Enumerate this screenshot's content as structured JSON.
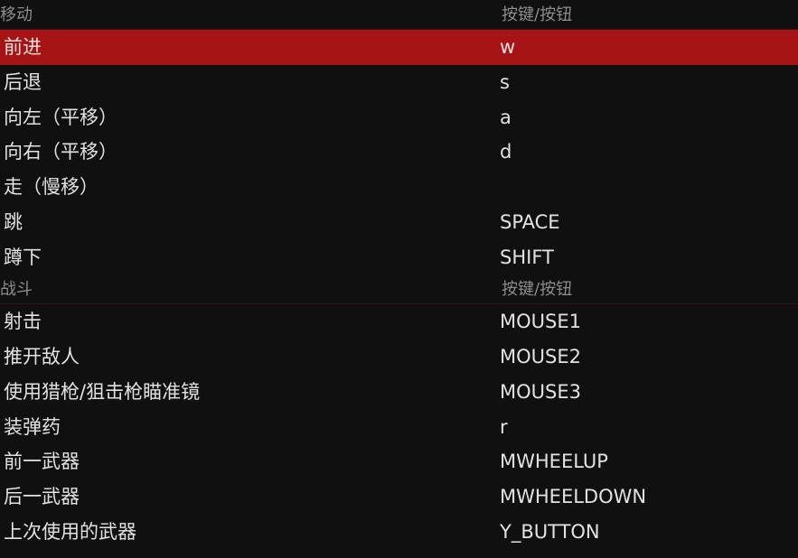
{
  "sections": [
    {
      "title": "移动",
      "key_header": "按键/按钮",
      "rows": [
        {
          "action": "前进",
          "key": "w",
          "selected": true
        },
        {
          "action": "后退",
          "key": "s"
        },
        {
          "action": "向左（平移）",
          "key": "a"
        },
        {
          "action": "向右（平移）",
          "key": "d"
        },
        {
          "action": "走（慢移）",
          "key": ""
        },
        {
          "action": "跳",
          "key": "SPACE"
        },
        {
          "action": "蹲下",
          "key": "SHIFT"
        }
      ]
    },
    {
      "title": "战斗",
      "key_header": "按键/按钮",
      "rows": [
        {
          "action": "射击",
          "key": "MOUSE1"
        },
        {
          "action": "推开敌人",
          "key": "MOUSE2"
        },
        {
          "action": "使用猎枪/狙击枪瞄准镜",
          "key": "MOUSE3"
        },
        {
          "action": "装弹药",
          "key": "r"
        },
        {
          "action": "前一武器",
          "key": "MWHEELUP"
        },
        {
          "action": "后一武器",
          "key": "MWHEELDOWN"
        },
        {
          "action": "上次使用的武器",
          "key": "Y_BUTTON"
        }
      ]
    }
  ],
  "colors": {
    "background": "#101010",
    "selected_row": "#a61416",
    "header_text": "#8c8c8c",
    "row_text": "#e2e2e2"
  }
}
